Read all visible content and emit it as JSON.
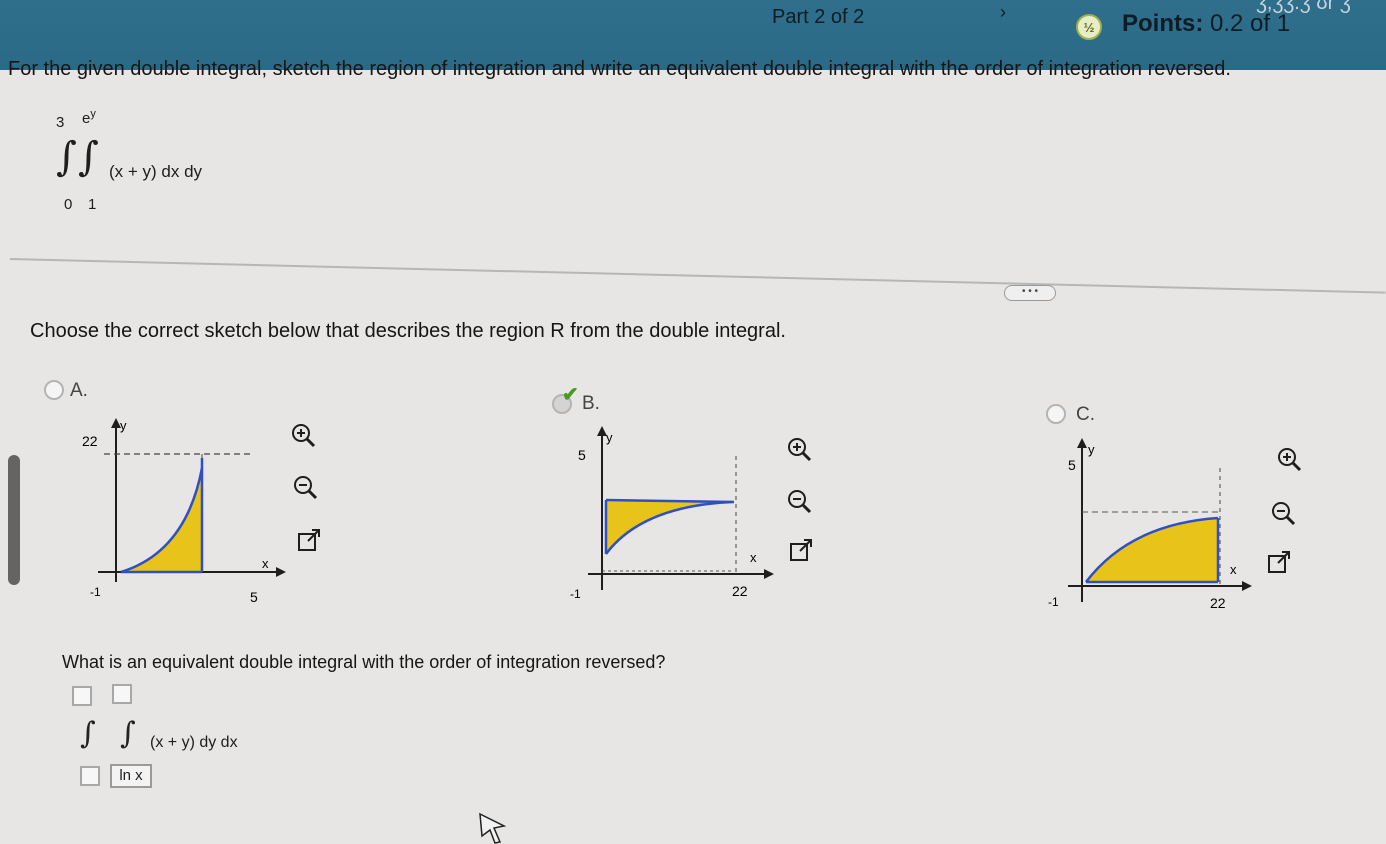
{
  "header": {
    "part": "Part 2 of 2",
    "nav_arrow": "›",
    "score_icon": "partial-score-icon",
    "points_label": "Points:",
    "points_value": "0.2 of 1",
    "corner_text": "ʒ,ʒʒ.ʒ ʊɾ ʒ"
  },
  "instruction": "For the given double integral, sketch the region of integration and write an equivalent double integral with the order of integration reversed.",
  "given_integral": {
    "outer_upper": "3",
    "outer_lower": "0",
    "inner_upper": "e",
    "inner_upper_exp": "y",
    "inner_lower": "1",
    "integrand": "(x + y) dx dy"
  },
  "more_button": "• • •",
  "question1": "Choose the correct sketch below that describes the region R from the double integral.",
  "options": [
    {
      "label": "A.",
      "selected": false,
      "graph": {
        "y_label": "y",
        "x_label": "x",
        "y_tick": "22",
        "x_tick": "5",
        "neg_tick": "-1"
      }
    },
    {
      "label": "B.",
      "selected": true,
      "graph": {
        "y_label": "y",
        "x_label": "x",
        "y_tick": "5",
        "x_tick": "22",
        "neg_tick": "-1"
      }
    },
    {
      "label": "C.",
      "selected": false,
      "graph": {
        "y_label": "y",
        "x_label": "x",
        "y_tick": "5",
        "x_tick": "22",
        "neg_tick": "-1"
      }
    }
  ],
  "question2": "What is an equivalent double integral with the order of integration reversed?",
  "answer": {
    "integrand": "(x + y) dy dx",
    "inner_lower": "ln x"
  },
  "colors": {
    "header_bg": "#2f6f8c",
    "region_fill": "#e8c41a",
    "boundary": "#2f4fc4",
    "correct_check": "#4a9a22"
  }
}
